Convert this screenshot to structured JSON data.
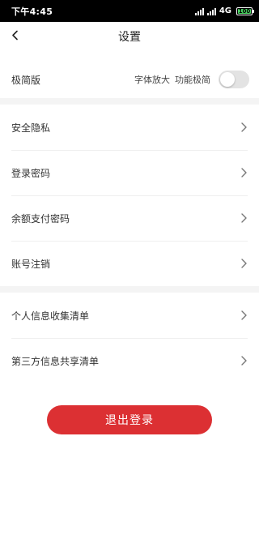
{
  "status_bar": {
    "time": "下午4:45",
    "network": "4G",
    "battery": "100",
    "battery_level": 1.0
  },
  "nav": {
    "title": "设置",
    "back_icon": "chevron-left-icon"
  },
  "mode_row": {
    "label": "极简版",
    "options": [
      "字体放大",
      "功能极简"
    ],
    "toggle_on": false
  },
  "menu_group_1": {
    "items": [
      {
        "label": "安全隐私"
      },
      {
        "label": "登录密码"
      },
      {
        "label": "余额支付密码"
      },
      {
        "label": "账号注销"
      }
    ]
  },
  "menu_group_2": {
    "items": [
      {
        "label": "个人信息收集清单"
      },
      {
        "label": "第三方信息共享清单"
      }
    ]
  },
  "logout": {
    "label": "退出登录"
  },
  "colors": {
    "accent": "#dc3033",
    "section_gap": "#f4f4f4",
    "toggle_off": "#e3e3e3"
  }
}
